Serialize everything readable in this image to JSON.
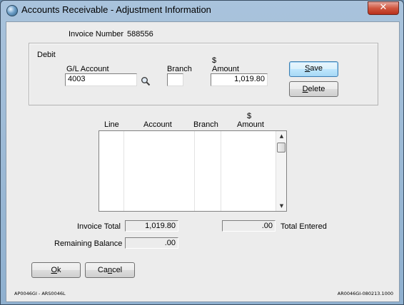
{
  "window": {
    "title": "Accounts Receivable - Adjustment Information",
    "close_label": "✕"
  },
  "invoice": {
    "label": "Invoice Number",
    "number": "588556"
  },
  "debit": {
    "group_label": "Debit",
    "gl_account_label": "G/L Account",
    "gl_account_value": "4003",
    "branch_label": "Branch",
    "branch_value": "",
    "amount_symbol": "$",
    "amount_label": "Amount",
    "amount_value": "1,019.80",
    "search_icon": "magnifier-icon"
  },
  "buttons": {
    "save": "Save",
    "save_mnemonic": "S",
    "save_rest": "ave",
    "delete": "Delete",
    "delete_mnemonic": "D",
    "delete_rest": "elete",
    "ok_mnemonic": "O",
    "ok_rest": "k",
    "cancel_pre": "Ca",
    "cancel_mnemonic": "n",
    "cancel_rest": "cel"
  },
  "table": {
    "columns": {
      "line": "Line",
      "account": "Account",
      "branch": "Branch",
      "amount_symbol": "$",
      "amount": "Amount"
    },
    "rows": []
  },
  "totals": {
    "invoice_total_label": "Invoice Total",
    "invoice_total_value": "1,019.80",
    "total_entered_value": ".00",
    "total_entered_label": "Total Entered",
    "remaining_balance_label": "Remaining Balance",
    "remaining_balance_value": ".00"
  },
  "footer": {
    "left": "AP0046GI - ARS0046L",
    "right": "AR0046GI-080213.1000"
  }
}
